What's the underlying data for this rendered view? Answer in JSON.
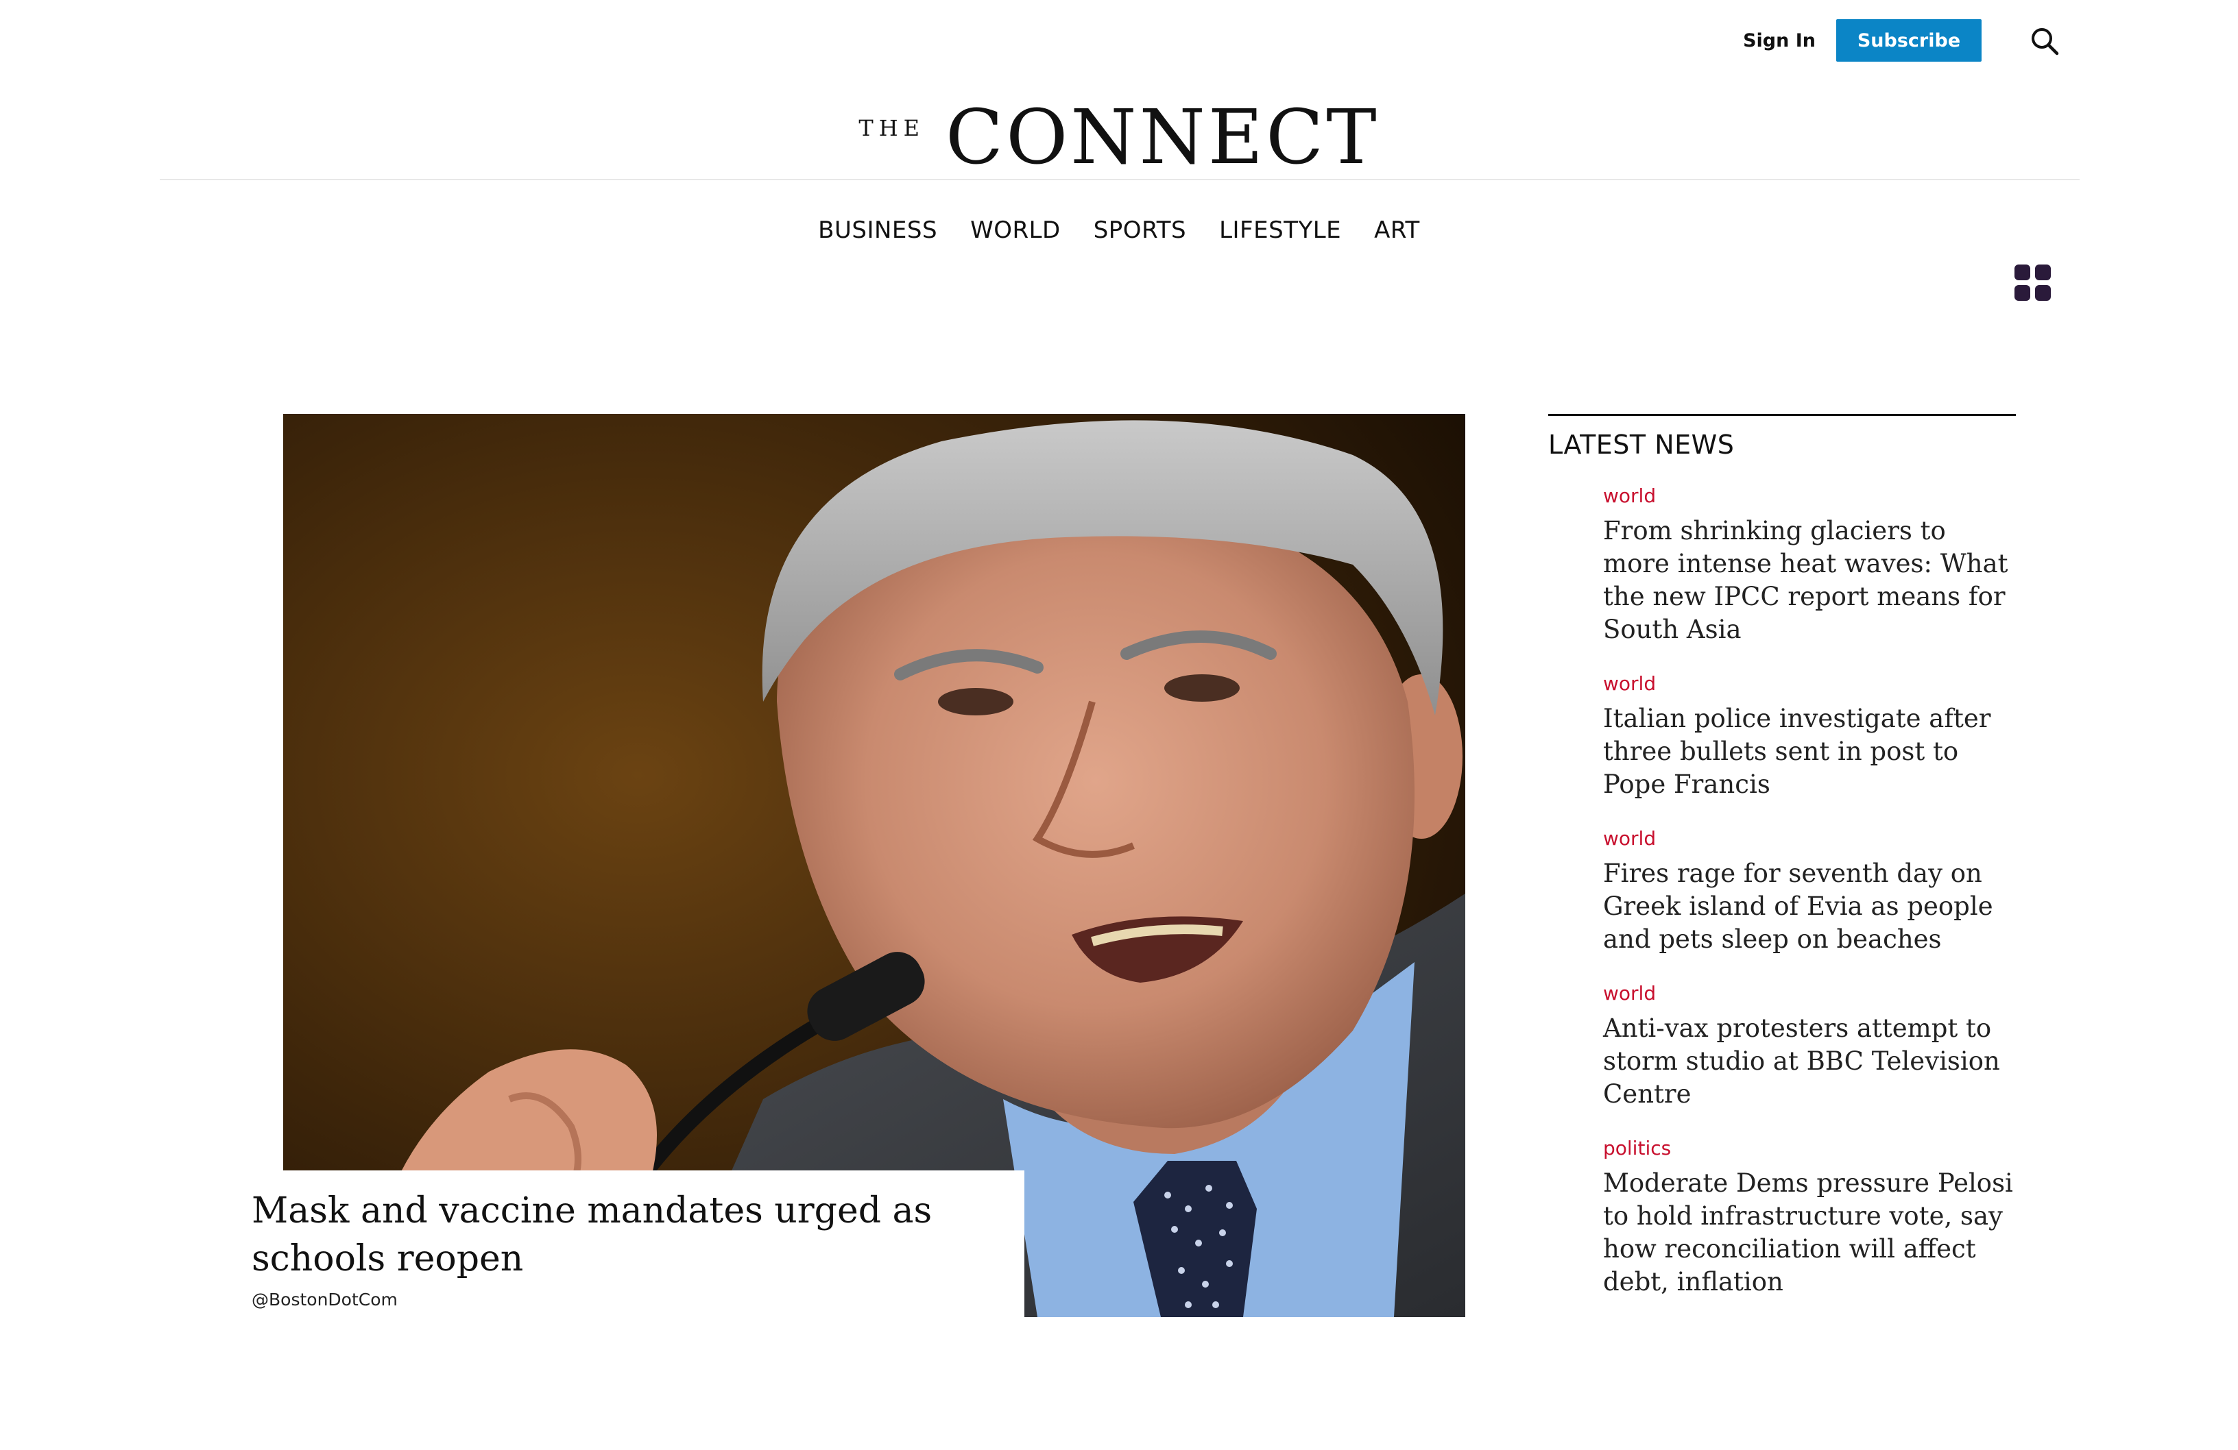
{
  "header": {
    "sign_in": "Sign In",
    "subscribe": "Subscribe",
    "masthead_prefix": "THE",
    "masthead_name": "CONNECT"
  },
  "nav": {
    "items": [
      "BUSINESS",
      "WORLD",
      "SPORTS",
      "LIFESTYLE",
      "ART"
    ]
  },
  "hero": {
    "title": "Mask and vaccine mandates urged as schools reopen",
    "source": "@BostonDotCom"
  },
  "latest": {
    "heading": "LATEST NEWS",
    "items": [
      {
        "category": "world",
        "title": "From shrinking glaciers to more intense heat waves: What the new IPCC report means for South Asia"
      },
      {
        "category": "world",
        "title": "Italian police investigate after three bullets sent in post to Pope Francis"
      },
      {
        "category": "world",
        "title": "Fires rage for seventh day on Greek island of Evia as people and pets sleep on beaches"
      },
      {
        "category": "world",
        "title": "Anti-vax protesters attempt to storm studio at BBC Television Centre"
      },
      {
        "category": "politics",
        "title": "Moderate Dems pressure Pelosi to hold infrastructure vote, say how reconciliation will affect debt, inflation"
      }
    ]
  },
  "colors": {
    "accent": "#0b85c6",
    "category": "#c8102e",
    "text": "#111111"
  },
  "icons": {
    "search": "search-icon",
    "menu": "grid-menu-icon"
  }
}
